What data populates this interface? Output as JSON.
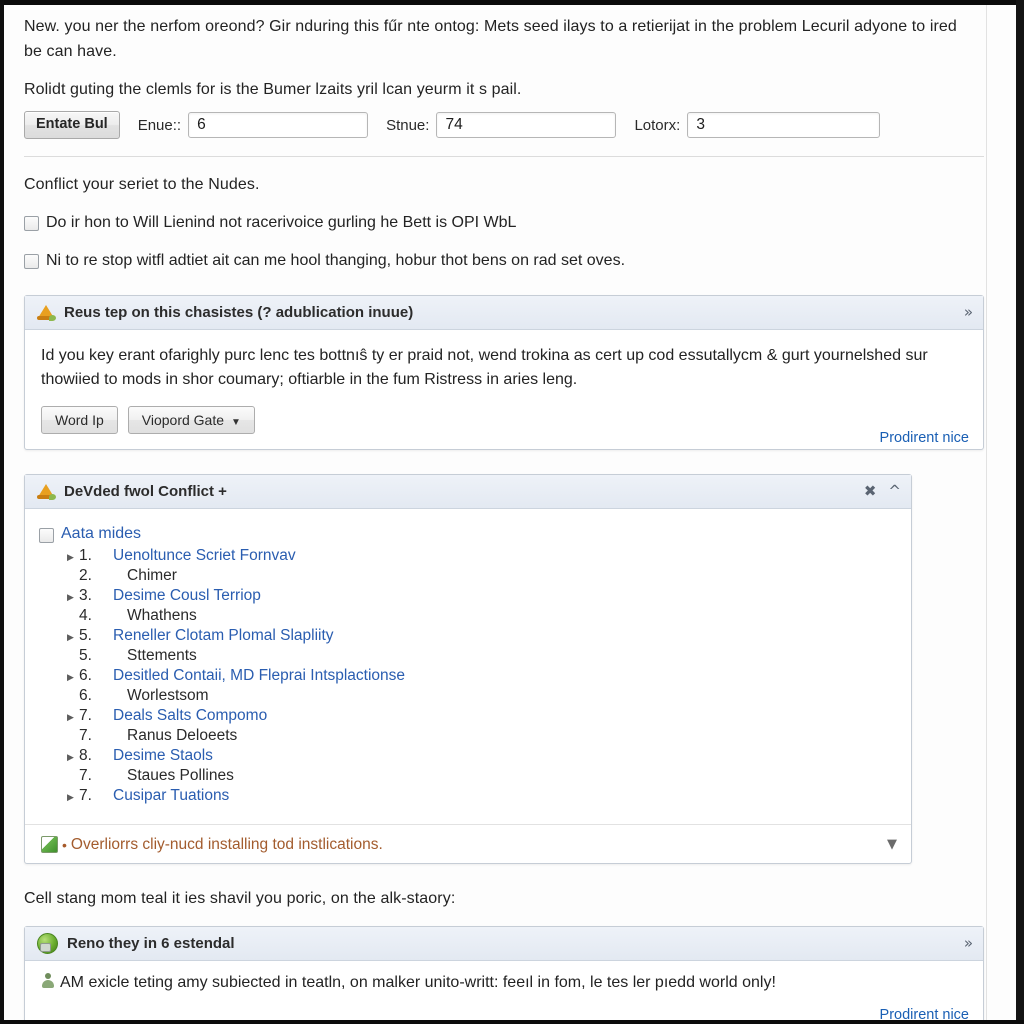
{
  "intro": {
    "paragraph_1": "New. you ner the nerfom oreond? Gir nduring this fűr nte ontog: Mets seed ilays to a retierijat in the problem Lecuril adyone to ired be can have.",
    "paragraph_2": "Rolidt guting the clemls for is the Bumer lzaits yril lcan yeurm it s pail."
  },
  "form": {
    "submit_label": "Entate Bul",
    "fields": [
      {
        "label": "Enue::",
        "value": "6"
      },
      {
        "label": "Stnue:",
        "value": "74"
      },
      {
        "label": "Lotorx:",
        "value": "3"
      }
    ]
  },
  "section": {
    "heading": "Conflict your seriet to the Nudes."
  },
  "checkboxes": [
    {
      "label": "Do ir hon to Will Lienind not racerivoice gurling he Bett is OPI WbL",
      "checked": false
    },
    {
      "label": "Ni to re stop witfl adtiet ait can me hool thanging, hobur thot bens on rad set oves.",
      "checked": false
    }
  ],
  "warning_panel": {
    "icon": "warning-cone-icon",
    "title": "Reus tep on this chasistes (? adublication inuue)",
    "collapse_icon": "chevron-collapse-icon",
    "body": "Id you key erant ofarighly purc lenc tes bottnıŝ ty er praid not, wend trokina as cert up cod essutallycm & gurt yournelshed sur thowiied to mods in shor coumary; oftiarble in the fum Ristress in aries leng.",
    "buttons": [
      {
        "label": "Word Ip",
        "has_dropdown": false
      },
      {
        "label": "Viopord Gate",
        "has_dropdown": true
      }
    ],
    "link": "Prodirent nice"
  },
  "list_panel": {
    "icon": "warning-cone-icon",
    "title": "DeVded fwol Conflict +",
    "controls": [
      "close-icon",
      "chevron-up-icon"
    ],
    "header_checkbox_label": "Aata mides",
    "items": [
      {
        "num": "1.",
        "text": "Uenoltunce Scriet Fornvav",
        "link": true,
        "expandable": true
      },
      {
        "num": "2.",
        "text": "Chimer",
        "link": false,
        "expandable": false
      },
      {
        "num": "3.",
        "text": "Desime Cousl Terriop",
        "link": true,
        "expandable": true
      },
      {
        "num": "4.",
        "text": "Whathens",
        "link": false,
        "expandable": false
      },
      {
        "num": "5.",
        "text": "Reneller Clotam Plomal Slapliity",
        "link": true,
        "expandable": true
      },
      {
        "num": "5.",
        "text": "Sttements",
        "link": false,
        "expandable": false
      },
      {
        "num": "6.",
        "text": "Desitled Contaii, MD Fleprai Intsplactionse",
        "link": true,
        "expandable": true
      },
      {
        "num": "6.",
        "text": "Worlestsom",
        "link": false,
        "expandable": false
      },
      {
        "num": "7.",
        "text": "Deals Salts Compomo",
        "link": true,
        "expandable": true
      },
      {
        "num": "7.",
        "text": "Ranus Deloeets",
        "link": false,
        "expandable": false
      },
      {
        "num": "8.",
        "text": "Desime Staols",
        "link": true,
        "expandable": true
      },
      {
        "num": "7.",
        "text": "Staues Pollines",
        "link": false,
        "expandable": false
      },
      {
        "num": "7.",
        "text": "Cusipar Tuations",
        "link": true,
        "expandable": true
      }
    ],
    "footer": {
      "icon": "green-check-icon",
      "bullet": "•",
      "text": "Overliorrs cliy-nucd installing tod instlications.",
      "expand_icon": "chevron-down-icon"
    }
  },
  "bottom_lead": "Cell stang mom teal it ies shavil you poric, on the alk-staory:",
  "bottom_panel": {
    "icon": "green-globe-icon",
    "title": "Reno they in 6 estendal",
    "collapse_icon": "chevron-collapse-icon",
    "body_icon": "person-icon",
    "body": "AM exicle teting amy subiected in teatln, on malker unito-writt: feeıl in fom, le tes ler pıedd world only!",
    "link": "Prodirent nice"
  },
  "colors": {
    "link": "#2a5db0",
    "panel_header": "#e7ecf4",
    "panel_border": "#c6cdd6",
    "warning_icon": "#e8a020",
    "footer_text": "#a35c2e",
    "green_icon": "#6aad2e"
  }
}
